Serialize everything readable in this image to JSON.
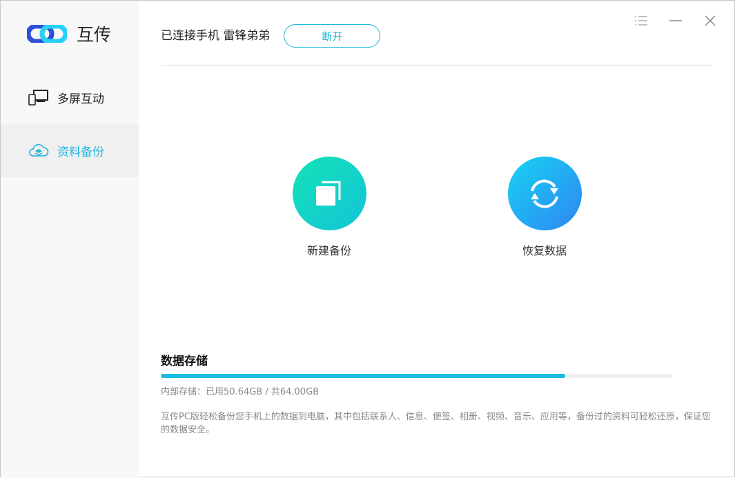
{
  "app": {
    "name": "互传"
  },
  "sidebar": {
    "items": [
      {
        "label": "多屏互动",
        "icon": "devices-icon"
      },
      {
        "label": "资料备份",
        "icon": "cloud-layers-icon",
        "active": true
      }
    ]
  },
  "header": {
    "connection": "已连接手机 雷锋弟弟",
    "disconnect_label": "断开"
  },
  "actions": [
    {
      "label": "新建备份",
      "icon": "copy-icon"
    },
    {
      "label": "恢复数据",
      "icon": "refresh-icon"
    }
  ],
  "storage": {
    "title": "数据存储",
    "used_fraction": 0.791,
    "info": "内部存储：已用50.64GB / 共64.00GB",
    "description": "互传PC版轻松备份您手机上的数据到电脑，其中包括联系人、信息、便签、相册、视频、音乐、应用等，备份过的资料可轻松还原，保证您的数据安全。"
  },
  "colors": {
    "accent": "#1ab6e0"
  }
}
